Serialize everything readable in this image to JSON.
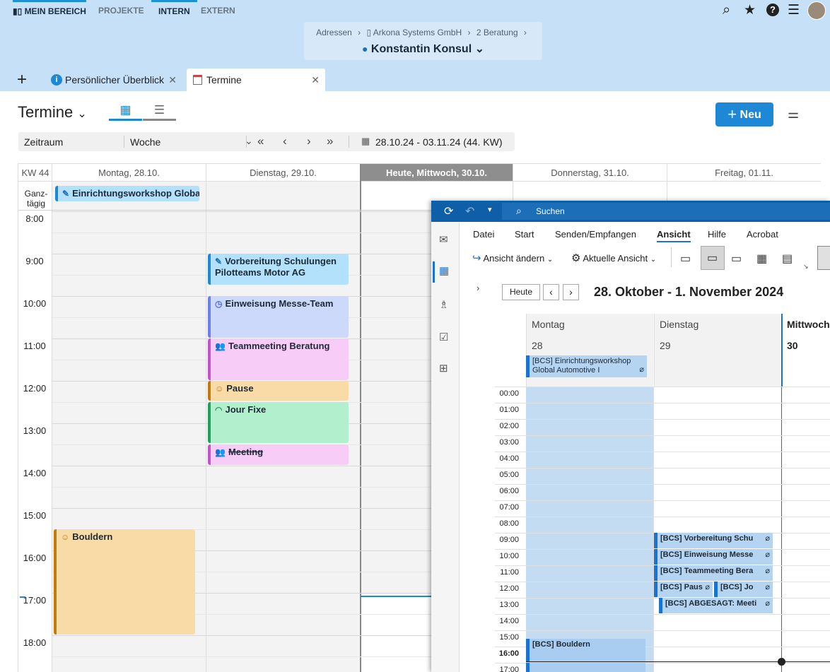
{
  "nav": {
    "tabs": [
      {
        "label": "MEIN BEREICH",
        "active": true
      },
      {
        "label": "PROJEKTE",
        "active": false
      },
      {
        "label": "INTERN",
        "active": true
      },
      {
        "label": "EXTERN",
        "active": false
      }
    ]
  },
  "breadcrumb": {
    "items": [
      "Adressen",
      "Arkona Systems GmbH",
      "2 Beratung"
    ],
    "separator": "›"
  },
  "person": "Konstantin Konsul",
  "page_tabs": [
    {
      "label": "Persönlicher Überblick",
      "icon": "info-icon"
    },
    {
      "label": "Termine",
      "icon": "calendar-icon"
    }
  ],
  "page": {
    "title": "Termine",
    "new_button": "Neu"
  },
  "filter": {
    "zeitraum_label": "Zeitraum",
    "zeitraum_value": "Woche",
    "date_range": "28.10.24 - 03.11.24 (44. KW)"
  },
  "calendar": {
    "week_label": "KW 44",
    "days": [
      "Montag, 28.10.",
      "Dienstag, 29.10.",
      "Heute, Mittwoch, 30.10.",
      "Donnerstag, 31.10.",
      "Freitag, 01.11."
    ],
    "allday_label": "Ganz-\ntägig",
    "hours": [
      "8:00",
      "9:00",
      "10:00",
      "11:00",
      "12:00",
      "13:00",
      "14:00",
      "15:00",
      "16:00",
      "17:00",
      "18:00"
    ],
    "events": {
      "allday": "Einrichtungsworkshop Global ...",
      "vorbereitung": "Vorbereitung Schulungen Pilotteams Motor AG",
      "einweisung": "Einweisung Messe-Team",
      "teammeeting": "Teammeeting Beratung",
      "pause": "Pause",
      "jourfixe": "Jour Fixe",
      "meeting": "Meeting",
      "bouldern": "Bouldern"
    },
    "colors": {
      "blue": "#b3e1fb",
      "lavender": "#cdd9fb",
      "pink": "#f7cdf7",
      "orange": "#f8dba7",
      "green": "#b2efcd"
    }
  },
  "outlook": {
    "search": "Suchen",
    "menu": [
      "Datei",
      "Start",
      "Senden/Empfangen",
      "Ansicht",
      "Hilfe",
      "Acrobat"
    ],
    "toolbar": {
      "change_view": "Ansicht ändern",
      "current_view": "Aktuelle Ansicht"
    },
    "today_button": "Heute",
    "range_title": "28. Oktober - 1. November 2024",
    "days": [
      {
        "name": "Montag",
        "num": "28"
      },
      {
        "name": "Dienstag",
        "num": "29"
      },
      {
        "name": "Mittwoch",
        "num": "30"
      }
    ],
    "hours": [
      "00:00",
      "01:00",
      "02:00",
      "03:00",
      "04:00",
      "05:00",
      "06:00",
      "07:00",
      "08:00",
      "09:00",
      "10:00",
      "11:00",
      "12:00",
      "13:00",
      "14:00",
      "15:00",
      "16:00",
      "17:00"
    ],
    "allday_event": "[BCS] Einrichtungsworkshop Global Automotive I",
    "events": {
      "vorbereitung": "[BCS] Vorbereitung Schu",
      "einweisung": "[BCS] Einweisung Messe",
      "teammeeting": "[BCS] Teammeeting Bera",
      "pause": "[BCS] Paus",
      "jf": "[BCS] Jo",
      "abgesagt": "[BCS] ABGESAGT: Meeti",
      "bouldern": "[BCS] Bouldern"
    }
  }
}
